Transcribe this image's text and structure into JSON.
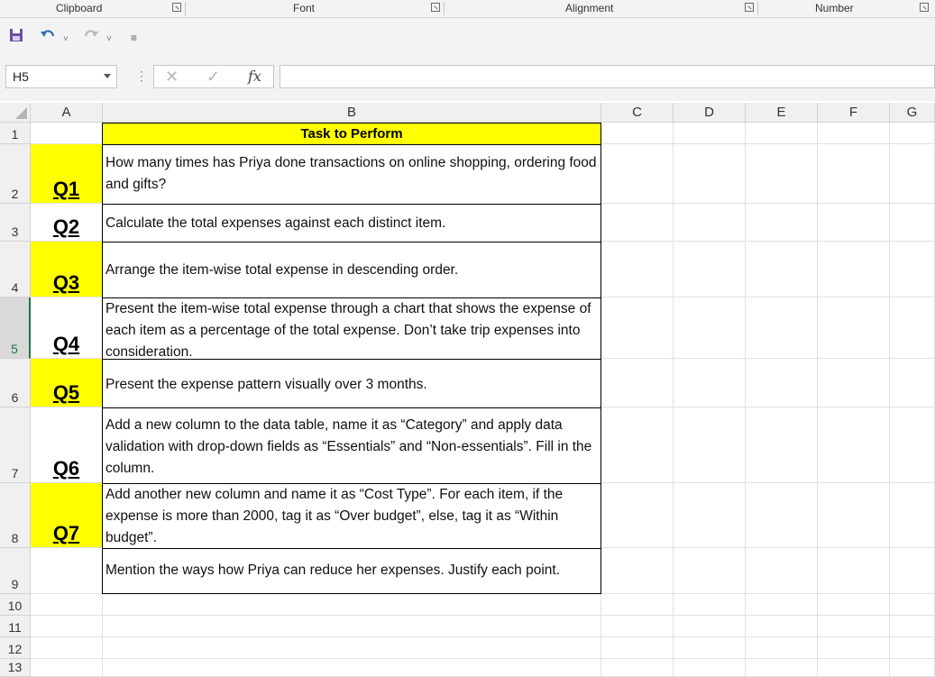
{
  "ribbon": {
    "groups": [
      "Clipboard",
      "Font",
      "Alignment",
      "Number"
    ]
  },
  "quick_access": {
    "save_icon": "save-icon",
    "undo_icon": "undo-icon",
    "redo_icon": "redo-icon",
    "customize_icon": "customize-icon"
  },
  "formula_bar": {
    "name_box": "H5",
    "fx_label": "fx",
    "cancel_glyph": "✕",
    "enter_glyph": "✓",
    "formula": ""
  },
  "grid": {
    "columns": [
      "A",
      "B",
      "C",
      "D",
      "E",
      "F",
      "G"
    ],
    "rows": [
      "1",
      "2",
      "3",
      "4",
      "5",
      "6",
      "7",
      "8",
      "9",
      "10",
      "11",
      "12",
      "13"
    ],
    "selected_row": "5",
    "header": "Task to Perform",
    "tasks": [
      {
        "q": "Q1",
        "text": "How many times has Priya done transactions on online shopping, ordering food and gifts?"
      },
      {
        "q": "Q2",
        "text": "Calculate the total expenses against each distinct item."
      },
      {
        "q": "Q3",
        "text": "Arrange the item-wise total expense in descending order."
      },
      {
        "q": "Q4",
        "text": "Present the item-wise total expense through a chart that shows the expense of each item as a percentage of the total expense. Don’t take trip expenses into consideration."
      },
      {
        "q": "Q5",
        "text": "Present the expense pattern visually over 3 months."
      },
      {
        "q": "Q6",
        "text": "Add a new column to the data table, name it as “Category” and apply data validation with drop-down fields as “Essentials” and “Non-essentials”. Fill in the column."
      },
      {
        "q": "Q7",
        "text": "Add another new column and name it as “Cost Type”. For each item, if the expense is more than 2000, tag it as “Over budget”, else, tag it as “Within budget”."
      },
      {
        "q": "",
        "text": "Mention the ways how Priya can reduce her expenses. Justify each point."
      }
    ]
  },
  "colors": {
    "highlight": "#ffff00",
    "accent": "#217346"
  }
}
